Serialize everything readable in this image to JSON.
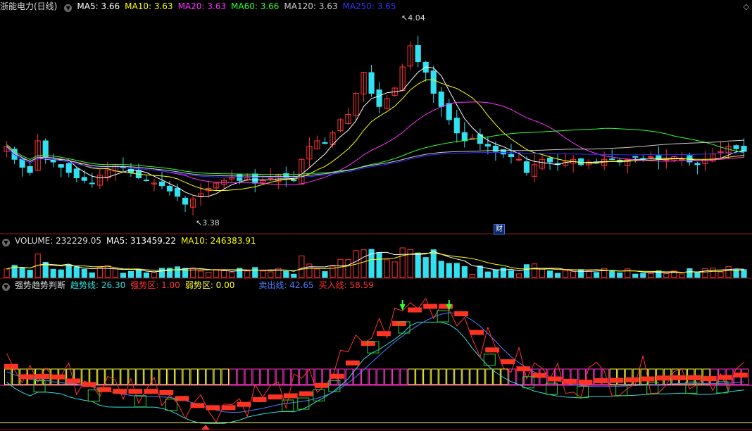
{
  "main_panel": {
    "title": "浙能电力(日线)",
    "ma": [
      {
        "label": "MA5: 3.66",
        "color": "#ffffff"
      },
      {
        "label": "MA10: 3.63",
        "color": "#ffff00"
      },
      {
        "label": "MA20: 3.63",
        "color": "#ff33ff"
      },
      {
        "label": "MA60: 3.66",
        "color": "#33ff33"
      },
      {
        "label": "MA120: 3.63",
        "color": "#cccccc"
      },
      {
        "label": "MA250: 3.65",
        "color": "#3333ff"
      }
    ],
    "high_label": "4.04",
    "low_label": "3.38",
    "badge": "财"
  },
  "volume_panel": {
    "labels": [
      {
        "label": "VOLUME: 232229.05",
        "color": "#dddddd"
      },
      {
        "label": "MA5: 313459.22",
        "color": "#ffffff"
      },
      {
        "label": "MA10: 246383.91",
        "color": "#ffff00"
      }
    ]
  },
  "indicator_panel": {
    "labels": [
      {
        "label": "强势趋势判断",
        "color": "#dddddd"
      },
      {
        "label": "趋势线: 26.30",
        "color": "#33dddd"
      },
      {
        "label": "强势区: 1.00",
        "color": "#ff3333"
      },
      {
        "label": "弱势区: 0.00",
        "color": "#ffff33"
      },
      {
        "label": "卖出线: 42.65",
        "color": "#4d7dff"
      },
      {
        "label": "买入线: 58.59",
        "color": "#ff3333"
      }
    ]
  },
  "colors": {
    "up": "#ff3333",
    "down": "#33e0f0",
    "grid": "#8b1a1a"
  },
  "chart_data": {
    "type": "candlestick",
    "close": [
      3.6,
      3.55,
      3.52,
      3.5,
      3.62,
      3.56,
      3.54,
      3.52,
      3.5,
      3.48,
      3.47,
      3.46,
      3.49,
      3.51,
      3.53,
      3.52,
      3.5,
      3.48,
      3.47,
      3.46,
      3.45,
      3.43,
      3.41,
      3.38,
      3.4,
      3.42,
      3.44,
      3.46,
      3.47,
      3.48,
      3.47,
      3.48,
      3.46,
      3.47,
      3.48,
      3.49,
      3.48,
      3.47,
      3.55,
      3.6,
      3.62,
      3.61,
      3.65,
      3.7,
      3.72,
      3.8,
      3.88,
      3.8,
      3.75,
      3.78,
      3.82,
      3.9,
      3.98,
      3.92,
      3.88,
      3.8,
      3.75,
      3.7,
      3.65,
      3.62,
      3.63,
      3.61,
      3.6,
      3.58,
      3.57,
      3.56,
      3.55,
      3.5,
      3.53,
      3.55,
      3.54,
      3.53,
      3.54,
      3.55,
      3.53,
      3.54,
      3.54,
      3.55,
      3.55,
      3.54,
      3.55,
      3.56,
      3.55,
      3.56,
      3.55,
      3.55,
      3.56,
      3.55,
      3.54,
      3.53,
      3.55,
      3.57,
      3.58,
      3.6,
      3.59,
      3.58
    ],
    "min_low": 3.38,
    "max_high": 4.04
  }
}
